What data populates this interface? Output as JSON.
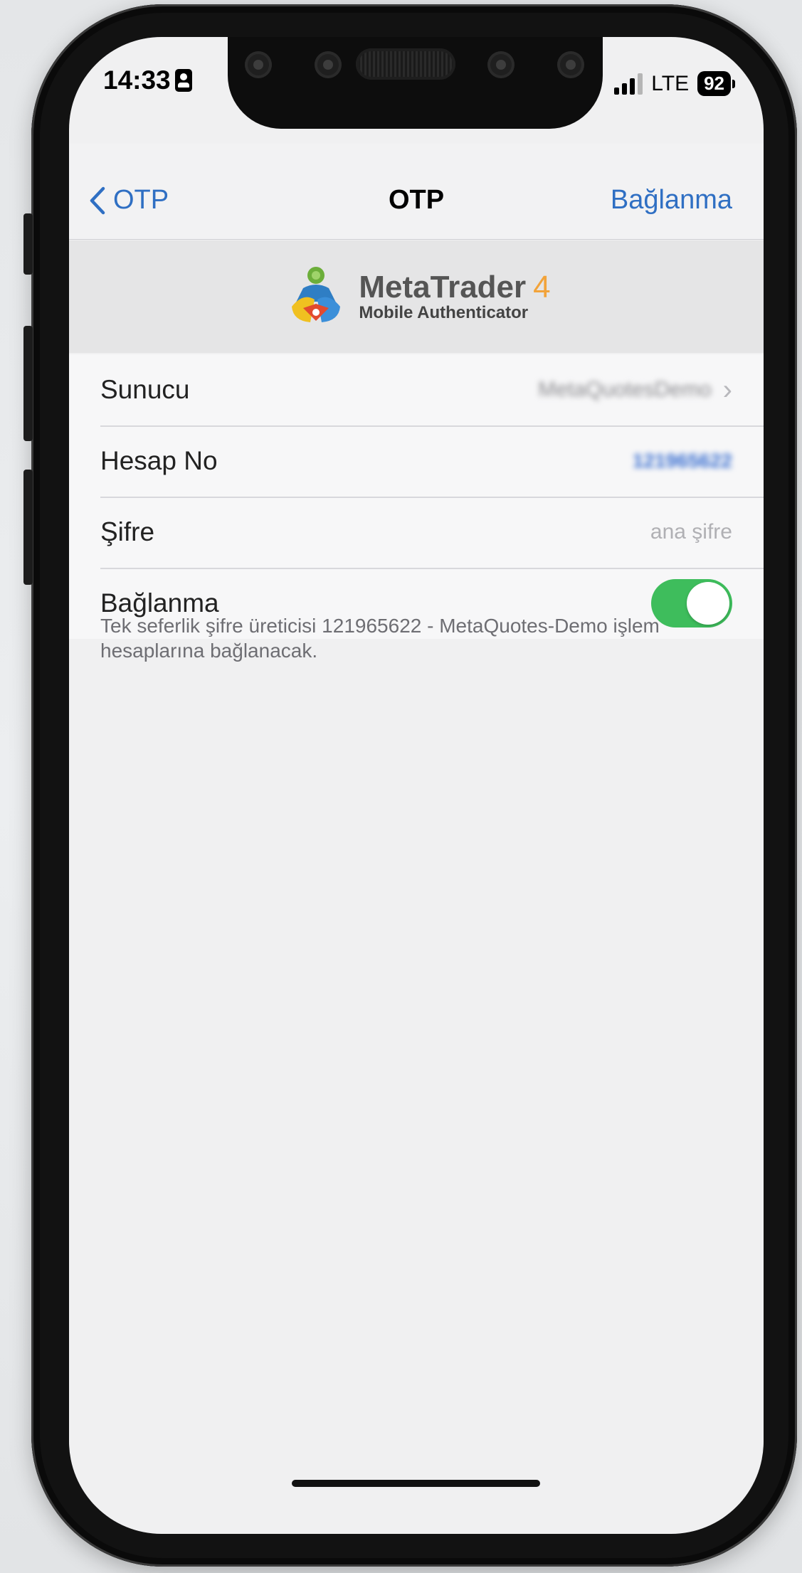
{
  "status_bar": {
    "time": "14:33",
    "network": "LTE",
    "battery": "92"
  },
  "nav": {
    "back_label": "OTP",
    "title": "OTP",
    "action_label": "Bağlanma"
  },
  "logo": {
    "brand": "MetaTrader",
    "brand_number": "4",
    "subtitle": "Mobile Authenticator"
  },
  "settings": {
    "server": {
      "label": "Sunucu",
      "value": "MetaQuotesDemo"
    },
    "account": {
      "label": "Hesap No",
      "value": "121965622"
    },
    "password": {
      "label": "Şifre",
      "placeholder": "ana şifre"
    },
    "connect": {
      "label": "Bağlanma",
      "enabled": true
    }
  },
  "footnote": "Tek seferlik şifre üreticisi 121965622 - MetaQuotes-Demo işlem hesaplarına bağlanacak.",
  "colors": {
    "accent": "#2f6fc3",
    "toggle_on": "#3ebd5c",
    "brand_orange": "#f2a33a"
  }
}
